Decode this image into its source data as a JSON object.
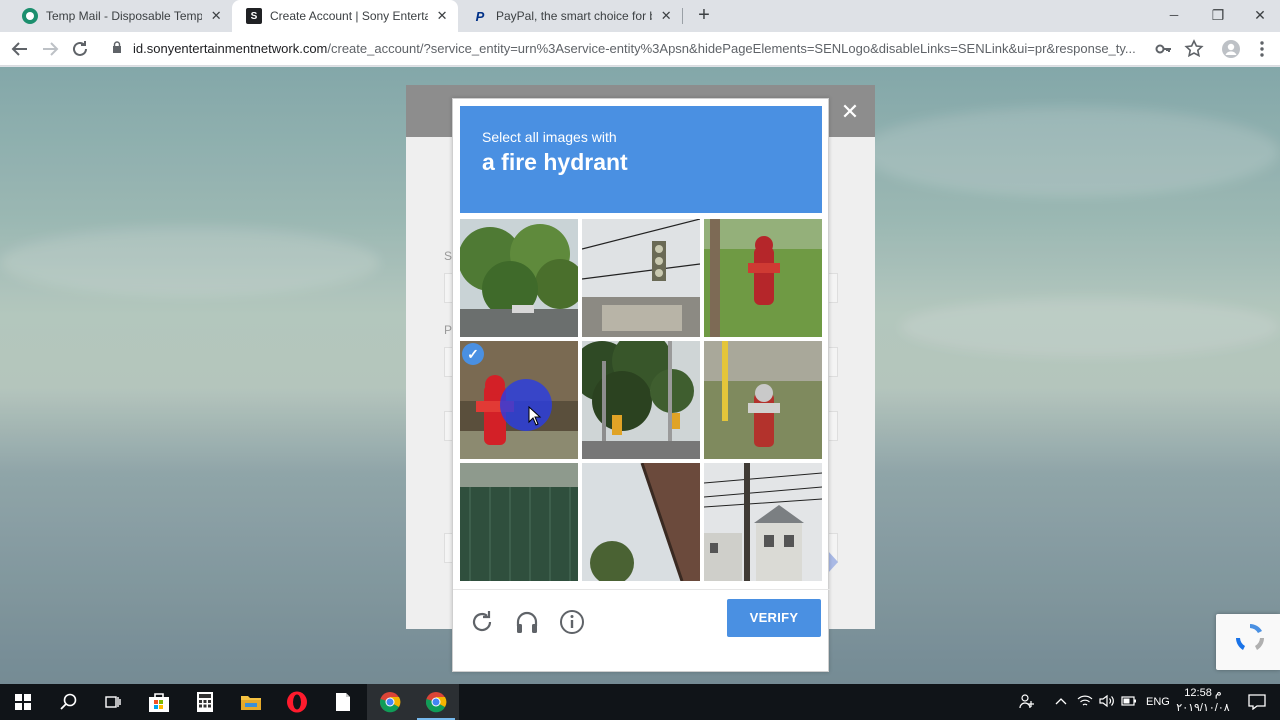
{
  "browser": {
    "tabs": [
      {
        "title": "Temp Mail - Disposable Tempora",
        "active": false,
        "favicon_color": "#1c8f6e"
      },
      {
        "title": "Create Account | Sony Entertainm",
        "active": true,
        "favicon_color": "#202124"
      },
      {
        "title": "PayPal, the smart choice for busi",
        "active": false,
        "favicon_color": "#003087"
      }
    ],
    "favicon_glyphs": [
      "",
      "S",
      "P"
    ],
    "new_tab_label": "+",
    "window_controls": {
      "minimize": "─",
      "maximize": "❐",
      "close": "✕"
    },
    "url_host": "id.sonyentertainmentnetwork.com",
    "url_path": "/create_account/?service_entity=urn%3Aservice-entity%3Apsn&hidePageElements=SENLogo&disableLinks=SENLink&ui=pr&response_ty..."
  },
  "signup": {
    "label_fragments": [
      "S",
      "P"
    ],
    "close_glyph": "✕"
  },
  "captcha": {
    "instruction": "Select all images with",
    "target": "a fire hydrant",
    "tiles": [
      {
        "content": "trees-road",
        "selected": false
      },
      {
        "content": "traffic-light",
        "selected": false
      },
      {
        "content": "fire-hydrant-grass",
        "selected": false
      },
      {
        "content": "fire-hydrant-red",
        "selected": true
      },
      {
        "content": "traffic-light-trees",
        "selected": false
      },
      {
        "content": "fire-hydrant-yellow-pole",
        "selected": false
      },
      {
        "content": "fence-trees",
        "selected": false
      },
      {
        "content": "awning-sky",
        "selected": false
      },
      {
        "content": "houses-wires",
        "selected": false
      }
    ],
    "check_glyph": "✓",
    "footer": {
      "reload_icon": "reload-icon",
      "audio_icon": "headphones-icon",
      "info_icon": "info-icon",
      "verify_label": "VERIFY"
    },
    "accent_color": "#4a90e2"
  },
  "taskbar": {
    "apps": [
      "start",
      "search",
      "task-view",
      "store",
      "calculator",
      "file-explorer",
      "opera",
      "notepad",
      "chrome",
      "chrome"
    ],
    "language": "ENG",
    "time": "12:58 م",
    "date": "٢٠١٩/١٠/٠٨"
  }
}
